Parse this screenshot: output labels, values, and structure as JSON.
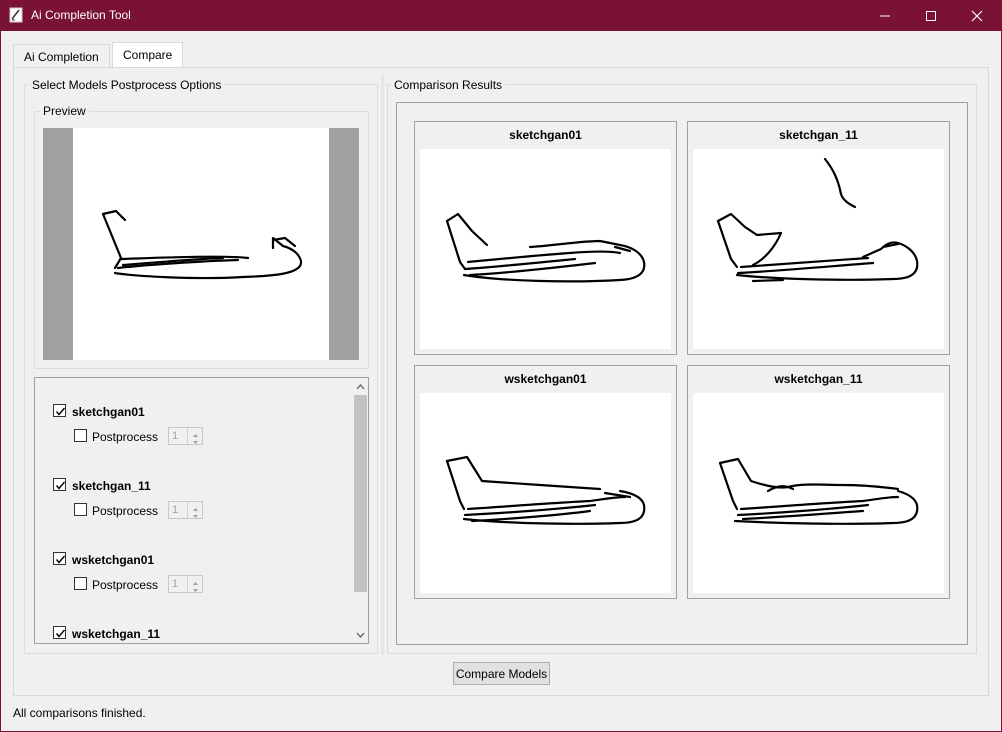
{
  "window": {
    "title": "Ai Completion Tool",
    "accent": "#7a1136"
  },
  "tabs": [
    {
      "label": "Ai Completion",
      "active": false
    },
    {
      "label": "Compare",
      "active": true
    }
  ],
  "left_panel": {
    "group_title": "Select Models  Postprocess Options",
    "preview_title": "Preview",
    "models": [
      {
        "name": "sketchgan01",
        "checked": true,
        "postprocess_label": "Postprocess",
        "postprocess_checked": false,
        "value": "1"
      },
      {
        "name": "sketchgan_11",
        "checked": true,
        "postprocess_label": "Postprocess",
        "postprocess_checked": false,
        "value": "1"
      },
      {
        "name": "wsketchgan01",
        "checked": true,
        "postprocess_label": "Postprocess",
        "postprocess_checked": false,
        "value": "1"
      },
      {
        "name": "wsketchgan_11",
        "checked": true
      }
    ]
  },
  "right_panel": {
    "group_title": "Comparison Results",
    "results": [
      {
        "title": "sketchgan01"
      },
      {
        "title": "sketchgan_11"
      },
      {
        "title": "wsketchgan01"
      },
      {
        "title": "wsketchgan_11"
      }
    ]
  },
  "compare_button": "Compare Models",
  "status": "All comparisons finished."
}
